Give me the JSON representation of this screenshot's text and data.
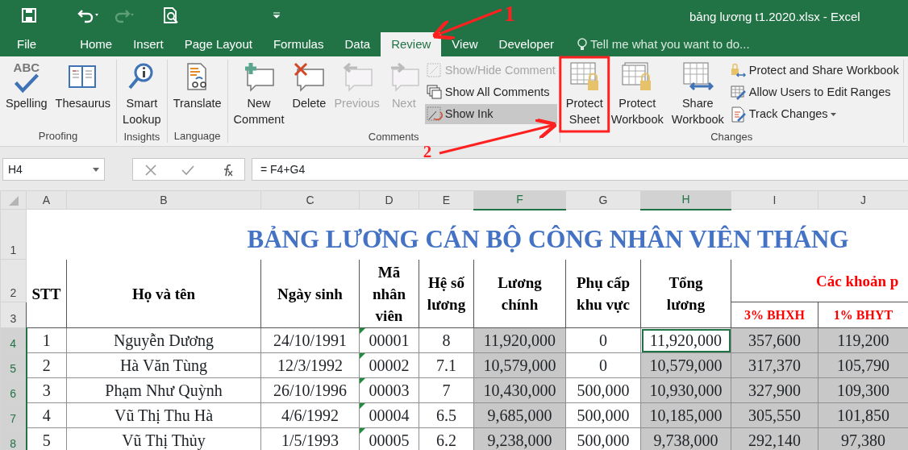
{
  "window": {
    "title": "bảng lương t1.2020.xlsx - Excel"
  },
  "quick_access": [
    {
      "kind": "save",
      "disabled": false
    },
    {
      "kind": "undo",
      "disabled": false
    },
    {
      "kind": "redo",
      "disabled": true
    },
    {
      "kind": "preview",
      "disabled": false
    },
    {
      "kind": "customize",
      "disabled": false
    }
  ],
  "tabs": [
    {
      "label": "File",
      "selected": false
    },
    {
      "label": "Home",
      "selected": false
    },
    {
      "label": "Insert",
      "selected": false
    },
    {
      "label": "Page Layout",
      "selected": false
    },
    {
      "label": "Formulas",
      "selected": false
    },
    {
      "label": "Data",
      "selected": false
    },
    {
      "label": "Review",
      "selected": true
    },
    {
      "label": "View",
      "selected": false
    },
    {
      "label": "Developer",
      "selected": false
    }
  ],
  "tell_me": {
    "placeholder": "Tell me what you want to do..."
  },
  "ribbon": {
    "groups": [
      {
        "label": "Proofing",
        "items": [
          {
            "kind": "large",
            "label": "Spelling",
            "icon_text": "ABC",
            "disabled": false,
            "pressed": false
          },
          {
            "kind": "large",
            "label": "Thesaurus",
            "disabled": false,
            "pressed": false
          }
        ]
      },
      {
        "label": "Insights",
        "items": [
          {
            "kind": "large",
            "label": "Smart\nLookup",
            "disabled": false,
            "pressed": false
          }
        ]
      },
      {
        "label": "Language",
        "items": [
          {
            "kind": "large",
            "label": "Translate",
            "disabled": false,
            "pressed": false
          }
        ]
      },
      {
        "label": "Comments",
        "items": [
          {
            "kind": "large",
            "label": "New\nComment",
            "disabled": false,
            "pressed": false
          },
          {
            "kind": "large",
            "label": "Delete",
            "disabled": false,
            "pressed": false
          },
          {
            "kind": "large",
            "label": "Previous",
            "disabled": true,
            "pressed": false
          },
          {
            "kind": "large",
            "label": "Next",
            "disabled": true,
            "pressed": false
          },
          {
            "kind": "small",
            "label": "Show/Hide Comment",
            "disabled": true,
            "pressed": false
          },
          {
            "kind": "small",
            "label": "Show All Comments",
            "disabled": false,
            "pressed": false
          },
          {
            "kind": "small",
            "label": "Show Ink",
            "disabled": false,
            "pressed": true
          }
        ]
      },
      {
        "label": "Changes",
        "items": [
          {
            "kind": "large",
            "label": "Protect\nSheet",
            "disabled": false,
            "pressed": false
          },
          {
            "kind": "large",
            "label": "Protect\nWorkbook",
            "disabled": false,
            "pressed": false
          },
          {
            "kind": "large",
            "label": "Share\nWorkbook",
            "disabled": false,
            "pressed": false
          },
          {
            "kind": "small",
            "label": "Protect and Share Workbook",
            "disabled": false,
            "pressed": false
          },
          {
            "kind": "small",
            "label": "Allow Users to Edit Ranges",
            "disabled": false,
            "pressed": false
          },
          {
            "kind": "small",
            "label": "Track Changes",
            "disabled": false,
            "pressed": false
          }
        ]
      }
    ]
  },
  "formula_bar": {
    "name_box": "H4",
    "formula": "= F4+G4"
  },
  "sheet": {
    "columns": [
      {
        "label": "A",
        "selected": false
      },
      {
        "label": "B",
        "selected": false
      },
      {
        "label": "C",
        "selected": false
      },
      {
        "label": "D",
        "selected": false
      },
      {
        "label": "E",
        "selected": false
      },
      {
        "label": "F",
        "selected": true
      },
      {
        "label": "G",
        "selected": false
      },
      {
        "label": "H",
        "selected": true
      },
      {
        "label": "I",
        "selected": false
      },
      {
        "label": "J",
        "selected": false
      }
    ],
    "title": {
      "row": "1",
      "text": "BẢNG LƯƠNG CÁN BỘ CÔNG NHÂN VIÊN THÁNG"
    },
    "header_rows": [
      "2",
      "3"
    ],
    "headers": [
      {
        "text": "STT",
        "color": "#000000"
      },
      {
        "text": "Họ và tên",
        "color": "#000000"
      },
      {
        "text": "Ngày sinh",
        "color": "#000000"
      },
      {
        "text": "Mã\nnhân\nviên",
        "color": "#000000"
      },
      {
        "text": "Hệ số\nlương",
        "color": "#000000"
      },
      {
        "text": "Lương\nchính",
        "color": "#000000"
      },
      {
        "text": "Phụ cấp\nkhu vực",
        "color": "#000000"
      },
      {
        "text": "Tổng\nlương",
        "color": "#000000"
      },
      {
        "text": "Các khoản p",
        "color": "#ff0000"
      }
    ],
    "subheaders": [
      {
        "text": "3% BHXH",
        "color": "#ff0000"
      },
      {
        "text": "1% BHYT",
        "color": "#ff0000"
      }
    ],
    "rows": [
      {
        "label": "4",
        "selected": true,
        "cells": [
          {
            "text": "1",
            "shaded": false,
            "active": false,
            "flagged": false
          },
          {
            "text": "Nguyễn Dương",
            "shaded": false,
            "active": false,
            "flagged": false
          },
          {
            "text": "24/10/1991",
            "shaded": false,
            "active": false,
            "flagged": false
          },
          {
            "text": "00001",
            "shaded": false,
            "active": false,
            "flagged": true
          },
          {
            "text": "8",
            "shaded": false,
            "active": false,
            "flagged": false
          },
          {
            "text": "11,920,000",
            "shaded": true,
            "active": false,
            "flagged": false
          },
          {
            "text": "0",
            "shaded": false,
            "active": false,
            "flagged": false
          },
          {
            "text": "11,920,000",
            "shaded": false,
            "active": true,
            "flagged": false
          },
          {
            "text": "357,600",
            "shaded": true,
            "active": false,
            "flagged": false
          },
          {
            "text": "119,200",
            "shaded": true,
            "active": false,
            "flagged": false
          }
        ]
      },
      {
        "label": "5",
        "selected": true,
        "cells": [
          {
            "text": "2",
            "shaded": false,
            "active": false,
            "flagged": false
          },
          {
            "text": "Hà Văn Tùng",
            "shaded": false,
            "active": false,
            "flagged": false
          },
          {
            "text": "12/3/1992",
            "shaded": false,
            "active": false,
            "flagged": false
          },
          {
            "text": "00002",
            "shaded": false,
            "active": false,
            "flagged": true
          },
          {
            "text": "7.1",
            "shaded": false,
            "active": false,
            "flagged": false
          },
          {
            "text": "10,579,000",
            "shaded": true,
            "active": false,
            "flagged": false
          },
          {
            "text": "0",
            "shaded": false,
            "active": false,
            "flagged": false
          },
          {
            "text": "10,579,000",
            "shaded": true,
            "active": false,
            "flagged": false
          },
          {
            "text": "317,370",
            "shaded": true,
            "active": false,
            "flagged": false
          },
          {
            "text": "105,790",
            "shaded": true,
            "active": false,
            "flagged": false
          }
        ]
      },
      {
        "label": "6",
        "selected": true,
        "cells": [
          {
            "text": "3",
            "shaded": false,
            "active": false,
            "flagged": false
          },
          {
            "text": "Phạm Như Quỳnh",
            "shaded": false,
            "active": false,
            "flagged": false
          },
          {
            "text": "26/10/1996",
            "shaded": false,
            "active": false,
            "flagged": false
          },
          {
            "text": "00003",
            "shaded": false,
            "active": false,
            "flagged": true
          },
          {
            "text": "7",
            "shaded": false,
            "active": false,
            "flagged": false
          },
          {
            "text": "10,430,000",
            "shaded": true,
            "active": false,
            "flagged": false
          },
          {
            "text": "500,000",
            "shaded": false,
            "active": false,
            "flagged": false
          },
          {
            "text": "10,930,000",
            "shaded": true,
            "active": false,
            "flagged": false
          },
          {
            "text": "327,900",
            "shaded": true,
            "active": false,
            "flagged": false
          },
          {
            "text": "109,300",
            "shaded": true,
            "active": false,
            "flagged": false
          }
        ]
      },
      {
        "label": "7",
        "selected": true,
        "cells": [
          {
            "text": "4",
            "shaded": false,
            "active": false,
            "flagged": false
          },
          {
            "text": "Vũ Thị Thu Hà",
            "shaded": false,
            "active": false,
            "flagged": false
          },
          {
            "text": "4/6/1992",
            "shaded": false,
            "active": false,
            "flagged": false
          },
          {
            "text": "00004",
            "shaded": false,
            "active": false,
            "flagged": true
          },
          {
            "text": "6.5",
            "shaded": false,
            "active": false,
            "flagged": false
          },
          {
            "text": "9,685,000",
            "shaded": true,
            "active": false,
            "flagged": false
          },
          {
            "text": "500,000",
            "shaded": false,
            "active": false,
            "flagged": false
          },
          {
            "text": "10,185,000",
            "shaded": true,
            "active": false,
            "flagged": false
          },
          {
            "text": "305,550",
            "shaded": true,
            "active": false,
            "flagged": false
          },
          {
            "text": "101,850",
            "shaded": true,
            "active": false,
            "flagged": false
          }
        ]
      },
      {
        "label": "8",
        "selected": true,
        "cells": [
          {
            "text": "5",
            "shaded": false,
            "active": false,
            "flagged": false
          },
          {
            "text": "Vũ Thị Thủy",
            "shaded": false,
            "active": false,
            "flagged": false
          },
          {
            "text": "1/5/1993",
            "shaded": false,
            "active": false,
            "flagged": false
          },
          {
            "text": "00005",
            "shaded": false,
            "active": false,
            "flagged": true
          },
          {
            "text": "6.2",
            "shaded": false,
            "active": false,
            "flagged": false
          },
          {
            "text": "9,238,000",
            "shaded": true,
            "active": false,
            "flagged": false
          },
          {
            "text": "500,000",
            "shaded": false,
            "active": false,
            "flagged": false
          },
          {
            "text": "9,738,000",
            "shaded": true,
            "active": false,
            "flagged": false
          },
          {
            "text": "292,140",
            "shaded": true,
            "active": false,
            "flagged": false
          },
          {
            "text": "97,380",
            "shaded": true,
            "active": false,
            "flagged": false
          }
        ]
      }
    ]
  },
  "annotations": [
    {
      "label": "1"
    },
    {
      "label": "2"
    }
  ]
}
